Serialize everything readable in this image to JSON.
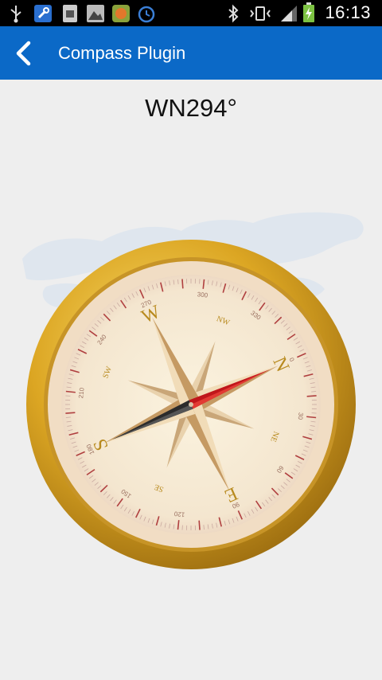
{
  "status_bar": {
    "time": "16:13",
    "icons": [
      "usb-icon",
      "app-tool-icon",
      "sim-toolkit-icon",
      "photo-icon",
      "game-icon",
      "alarm-icon",
      "bluetooth-icon",
      "vibrate-icon",
      "signal-icon",
      "battery-charging-icon"
    ]
  },
  "app_bar": {
    "title": "Compass Plugin",
    "back_icon": "chevron-left-icon"
  },
  "heading": "WN294°",
  "compass": {
    "cardinals": [
      "N",
      "E",
      "S",
      "W"
    ],
    "intercardinals": [
      "NE",
      "SE",
      "SW",
      "NW"
    ],
    "degree_labels": [
      "0",
      "30",
      "60",
      "90",
      "120",
      "150",
      "180",
      "210",
      "240",
      "270",
      "300",
      "330"
    ],
    "needle_heading_deg": 294,
    "colors": {
      "gold": "#d9a521",
      "face": "#f6ead9",
      "needle_north": "#c0161b",
      "needle_south": "#2b2b2b",
      "letters": "#b88a1e"
    }
  }
}
